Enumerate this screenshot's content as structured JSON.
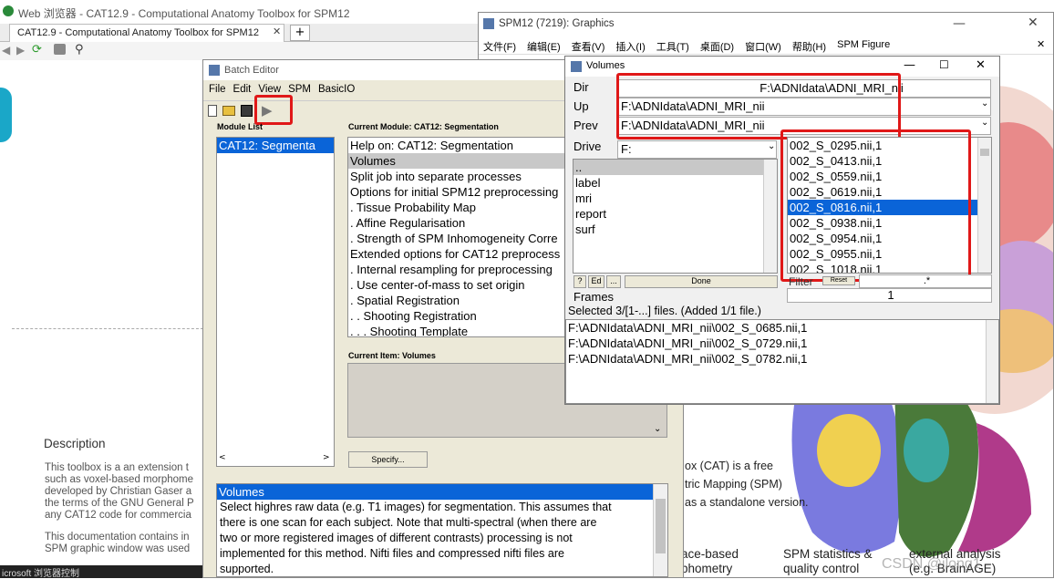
{
  "browser": {
    "title": "Web 浏览器 - CAT12.9 - Computational Anatomy Toolbox for SPM12",
    "tab_label": "CAT12.9 - Computational Anatomy Toolbox for SPM12",
    "new_tab": "+",
    "description_heading": "Description",
    "description_lines": [
      "This toolbox is a an extension t",
      "such as voxel-based morphome",
      "developed by Christian Gaser a",
      "the terms of the GNU General P",
      "any CAT12 code for commercia"
    ],
    "description_lines2": [
      "This documentation contains in",
      "SPM graphic window was used"
    ],
    "taskbar_text": "icrosoft  浏览器控制"
  },
  "batch": {
    "title": "Batch Editor",
    "menu": [
      "File",
      "Edit",
      "View",
      "SPM",
      "BasicIO"
    ],
    "module_list_label": "Module List",
    "modules": [
      "CAT12: Segmenta"
    ],
    "current_module_label": "Current Module: CAT12: Segmentation",
    "current_module_items": [
      "Help on: CAT12: Segmentation",
      "Volumes",
      "Split job into separate processes",
      "Options for initial SPM12 preprocessing",
      " . Tissue Probability Map",
      " . Affine Regularisation",
      " . Strength of SPM Inhomogeneity Corre",
      "Extended options for CAT12 preprocess",
      " . Internal resampling for preprocessing",
      " . Use center-of-mass to set origin",
      " . Spatial Registration",
      " . . Shooting Registration",
      " . . . Shooting Template"
    ],
    "current_item_label": "Current Item: Volumes",
    "specify_button": "Specify...",
    "help_title": "Volumes",
    "help_lines": [
      "Select highres raw data (e.g. T1 images) for segmentation. This assumes that",
      "there  is  one  scan  for  each subject. Note that multi-spectral (when there are",
      "two  or  more  registered  images  of  different  contrasts)  processing  is  not",
      "implemented   for   this   method.   Nifti   files   and  compressed  nifti  files  are",
      "supported."
    ]
  },
  "graphics": {
    "title": "SPM12 (7219): Graphics",
    "menu": [
      "文件(F)",
      "编辑(E)",
      "查看(V)",
      "插入(I)",
      "工具(T)",
      "桌面(D)",
      "窗口(W)",
      "帮助(H)",
      "SPM Figure"
    ],
    "text_fragments": [
      "ox (CAT) is a free",
      "tric Mapping (SPM)",
      "as a standalone version."
    ],
    "bottom_labels": [
      {
        "line1": "ace-based",
        "line2": "phometry"
      },
      {
        "line1": "SPM statistics &",
        "line2": "quality control"
      },
      {
        "line1": "external analysis",
        "line2": "(e.g. BrainAGE)"
      }
    ],
    "watermark": "CSDN @jlong1"
  },
  "volumes": {
    "title": "Volumes",
    "dir_label": "Dir",
    "dir_value": "F:\\ADNIdata\\ADNI_MRI_nii",
    "up_label": "Up",
    "up_value": "F:\\ADNIdata\\ADNI_MRI_nii",
    "prev_label": "Prev",
    "prev_value": "F:\\ADNIdata\\ADNI_MRI_nii",
    "drive_label": "Drive",
    "drive_value": "F:",
    "folders": [
      "..",
      "label",
      "mri",
      "report",
      "surf"
    ],
    "files": [
      "002_S_0295.nii,1",
      "002_S_0413.nii,1",
      "002_S_0559.nii,1",
      "002_S_0619.nii,1",
      "002_S_0816.nii,1",
      "002_S_0938.nii,1",
      "002_S_0954.nii,1",
      "002_S_0955.nii,1",
      "002_S_1018.nii,1"
    ],
    "help_btn": "?",
    "ed_btn": "Ed",
    "dots_btn": "...",
    "done_btn": "Done",
    "filter_label": "Filter",
    "reset_btn": "Reset",
    "filter_value": ".*",
    "frames_label": "Frames",
    "frames_value": "1",
    "status": "Selected 3/[1-...] files. (Added 1/1 file.)",
    "selected": [
      "F:\\ADNIdata\\ADNI_MRI_nii\\002_S_0685.nii,1",
      "F:\\ADNIdata\\ADNI_MRI_nii\\002_S_0729.nii,1",
      "F:\\ADNIdata\\ADNI_MRI_nii\\002_S_0782.nii,1"
    ]
  },
  "colors": {
    "selection": "#0a64d8",
    "highlight_red": "#e01818",
    "window_bg": "#ece9d8"
  }
}
